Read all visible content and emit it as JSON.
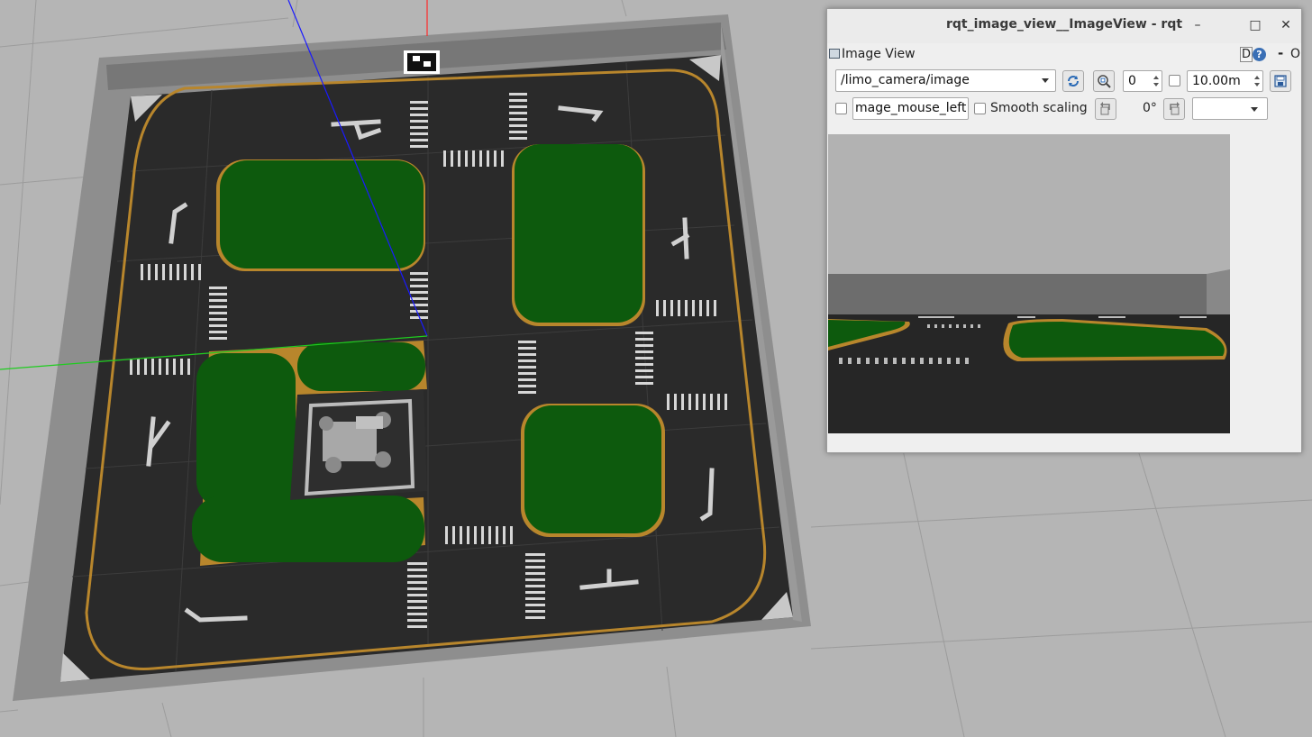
{
  "window": {
    "title": "rqt_image_view__ImageView - rqt",
    "minimize_glyph": "–",
    "maximize_glyph": "□",
    "close_glyph": "✕"
  },
  "plugin": {
    "title": "Image View",
    "d_button": "D",
    "help_glyph": "?",
    "minus_glyph": "-",
    "close_glyph": "O"
  },
  "toolbar": {
    "topic": "/limo_camera/image",
    "num_gridlines": "0",
    "max_range": "10.00m",
    "mouse_topic": "mage_mouse_left",
    "smooth_scaling_label": "Smooth scaling",
    "rotation": "0°",
    "color_scheme": ""
  },
  "icons": [
    "refresh-icon",
    "zoom-fit-icon",
    "save-icon",
    "rotate-left-icon",
    "rotate-right-icon",
    "image-view-icon"
  ],
  "colors": {
    "track_asphalt": "#2a2a2a",
    "grass": "#0d5a0d",
    "track_border_line": "#b8862c",
    "wall": "#8c8c8c",
    "ground": "#b5b5b5"
  }
}
